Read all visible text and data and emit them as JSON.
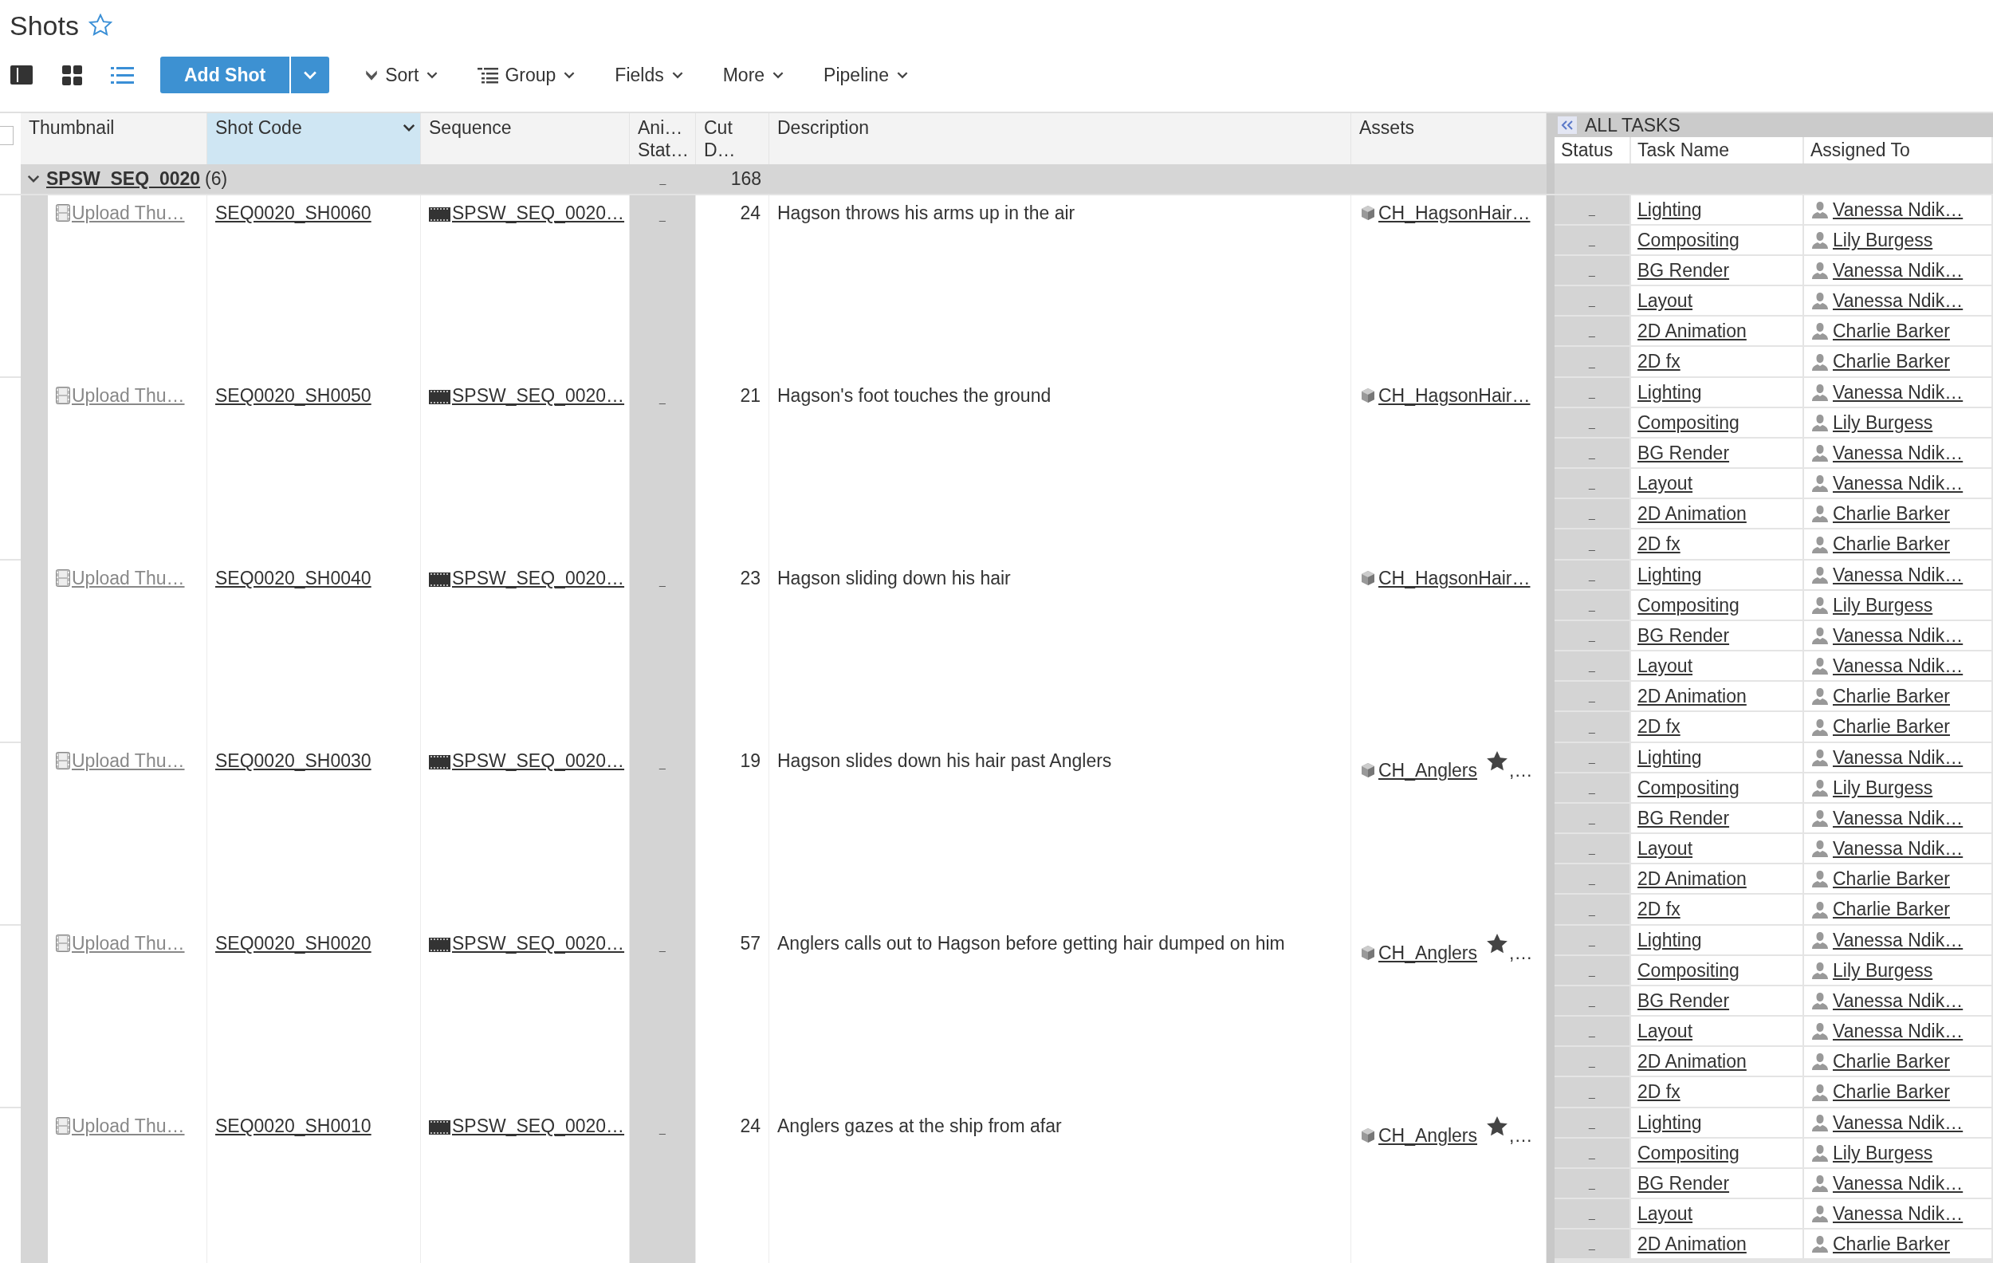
{
  "title": "Shots",
  "favorite": false,
  "view_modes": [
    {
      "selected": false
    },
    {
      "selected": false
    },
    {
      "selected": true
    }
  ],
  "add_button": "Add Shot",
  "menus": [
    {
      "label": "Sort",
      "kind": "sort"
    },
    {
      "label": "Group",
      "kind": "group"
    },
    {
      "label": "Fields",
      "kind": "plain"
    },
    {
      "label": "More",
      "kind": "plain"
    },
    {
      "label": "Pipeline",
      "kind": "plain"
    }
  ],
  "select_all": {
    "checked": false
  },
  "columns": [
    {
      "label": "Thumbnail",
      "selected": false
    },
    {
      "label": "Shot Code",
      "selected": true
    },
    {
      "label": "Sequence",
      "selected": false
    },
    {
      "label": "Ani… Stat…",
      "selected": false
    },
    {
      "label": "Cut D…",
      "selected": false
    },
    {
      "label": "Description",
      "selected": false
    },
    {
      "label": "Assets",
      "selected": false
    }
  ],
  "tasks_panel": {
    "title": "ALL TASKS",
    "columns": [
      "Status",
      "Task Name",
      "Assigned To"
    ]
  },
  "group": {
    "name": "SPSW_SEQ_0020",
    "count": "(6)",
    "expanded": true,
    "ani_status": "_",
    "cut_duration": "168"
  },
  "shots": [
    {
      "thumbnail": "Upload Thu…",
      "code": "SEQ0020_SH0060",
      "sequence": "SPSW_SEQ_0020…",
      "ani_status": "_",
      "cut_duration": "24",
      "description": "Hagson throws his arms up in the air",
      "assets": [
        {
          "name": "CH_HagsonHair…",
          "starred": false
        }
      ],
      "tasks": [
        {
          "status": "_",
          "name": "Lighting",
          "assignee": "Vanessa Ndik…"
        },
        {
          "status": "_",
          "name": "Compositing",
          "assignee": "Lily Burgess"
        },
        {
          "status": "_",
          "name": "BG Render",
          "assignee": "Vanessa Ndik…"
        },
        {
          "status": "_",
          "name": "Layout",
          "assignee": "Vanessa Ndik…"
        },
        {
          "status": "_",
          "name": "2D Animation",
          "assignee": "Charlie Barker"
        },
        {
          "status": "_",
          "name": "2D fx",
          "assignee": "Charlie Barker"
        }
      ]
    },
    {
      "thumbnail": "Upload Thu…",
      "code": "SEQ0020_SH0050",
      "sequence": "SPSW_SEQ_0020…",
      "ani_status": "_",
      "cut_duration": "21",
      "description": "Hagson's foot touches the ground",
      "assets": [
        {
          "name": "CH_HagsonHair…",
          "starred": false
        }
      ],
      "tasks": [
        {
          "status": "_",
          "name": "Lighting",
          "assignee": "Vanessa Ndik…"
        },
        {
          "status": "_",
          "name": "Compositing",
          "assignee": "Lily Burgess"
        },
        {
          "status": "_",
          "name": "BG Render",
          "assignee": "Vanessa Ndik…"
        },
        {
          "status": "_",
          "name": "Layout",
          "assignee": "Vanessa Ndik…"
        },
        {
          "status": "_",
          "name": "2D Animation",
          "assignee": "Charlie Barker"
        },
        {
          "status": "_",
          "name": "2D fx",
          "assignee": "Charlie Barker"
        }
      ]
    },
    {
      "thumbnail": "Upload Thu…",
      "code": "SEQ0020_SH0040",
      "sequence": "SPSW_SEQ_0020…",
      "ani_status": "_",
      "cut_duration": "23",
      "description": "Hagson sliding down his hair",
      "assets": [
        {
          "name": "CH_HagsonHair…",
          "starred": false
        }
      ],
      "tasks": [
        {
          "status": "_",
          "name": "Lighting",
          "assignee": "Vanessa Ndik…"
        },
        {
          "status": "_",
          "name": "Compositing",
          "assignee": "Lily Burgess"
        },
        {
          "status": "_",
          "name": "BG Render",
          "assignee": "Vanessa Ndik…"
        },
        {
          "status": "_",
          "name": "Layout",
          "assignee": "Vanessa Ndik…"
        },
        {
          "status": "_",
          "name": "2D Animation",
          "assignee": "Charlie Barker"
        },
        {
          "status": "_",
          "name": "2D fx",
          "assignee": "Charlie Barker"
        }
      ]
    },
    {
      "thumbnail": "Upload Thu…",
      "code": "SEQ0020_SH0030",
      "sequence": "SPSW_SEQ_0020…",
      "ani_status": "_",
      "cut_duration": "19",
      "description": "Hagson slides down his hair past Anglers",
      "assets": [
        {
          "name": "CH_Anglers",
          "starred": true
        }
      ],
      "assets_more": ",…",
      "tasks": [
        {
          "status": "_",
          "name": "Lighting",
          "assignee": "Vanessa Ndik…"
        },
        {
          "status": "_",
          "name": "Compositing",
          "assignee": "Lily Burgess"
        },
        {
          "status": "_",
          "name": "BG Render",
          "assignee": "Vanessa Ndik…"
        },
        {
          "status": "_",
          "name": "Layout",
          "assignee": "Vanessa Ndik…"
        },
        {
          "status": "_",
          "name": "2D Animation",
          "assignee": "Charlie Barker"
        },
        {
          "status": "_",
          "name": "2D fx",
          "assignee": "Charlie Barker"
        }
      ]
    },
    {
      "thumbnail": "Upload Thu…",
      "code": "SEQ0020_SH0020",
      "sequence": "SPSW_SEQ_0020…",
      "ani_status": "_",
      "cut_duration": "57",
      "description": "Anglers calls out to Hagson before getting hair dumped on him",
      "assets": [
        {
          "name": "CH_Anglers",
          "starred": true
        }
      ],
      "assets_more": ",…",
      "tasks": [
        {
          "status": "_",
          "name": "Lighting",
          "assignee": "Vanessa Ndik…"
        },
        {
          "status": "_",
          "name": "Compositing",
          "assignee": "Lily Burgess"
        },
        {
          "status": "_",
          "name": "BG Render",
          "assignee": "Vanessa Ndik…"
        },
        {
          "status": "_",
          "name": "Layout",
          "assignee": "Vanessa Ndik…"
        },
        {
          "status": "_",
          "name": "2D Animation",
          "assignee": "Charlie Barker"
        },
        {
          "status": "_",
          "name": "2D fx",
          "assignee": "Charlie Barker"
        }
      ]
    },
    {
      "thumbnail": "Upload Thu…",
      "code": "SEQ0020_SH0010",
      "sequence": "SPSW_SEQ_0020…",
      "ani_status": "_",
      "cut_duration": "24",
      "description": "Anglers gazes at the ship from afar",
      "assets": [
        {
          "name": "CH_Anglers",
          "starred": true
        }
      ],
      "assets_more": ",…",
      "tasks": [
        {
          "status": "_",
          "name": "Lighting",
          "assignee": "Vanessa Ndik…"
        },
        {
          "status": "_",
          "name": "Compositing",
          "assignee": "Lily Burgess"
        },
        {
          "status": "_",
          "name": "BG Render",
          "assignee": "Vanessa Ndik…"
        },
        {
          "status": "_",
          "name": "Layout",
          "assignee": "Vanessa Ndik…"
        },
        {
          "status": "_",
          "name": "2D Animation",
          "assignee": "Charlie Barker"
        }
      ]
    }
  ]
}
